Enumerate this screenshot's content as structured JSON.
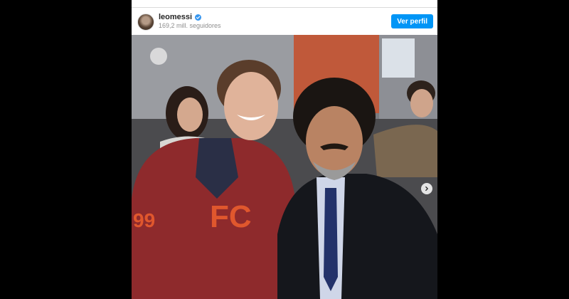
{
  "post": {
    "username": "leomessi",
    "followers": "169,2 mill. seguidores",
    "profile_button": "Ver perfil",
    "verified": true
  },
  "icons": {
    "avatar": "profile-avatar",
    "verified": "verified-badge-icon",
    "next": "chevron-right-icon"
  },
  "colors": {
    "accent": "#0095f6",
    "verified": "#3897f0"
  }
}
